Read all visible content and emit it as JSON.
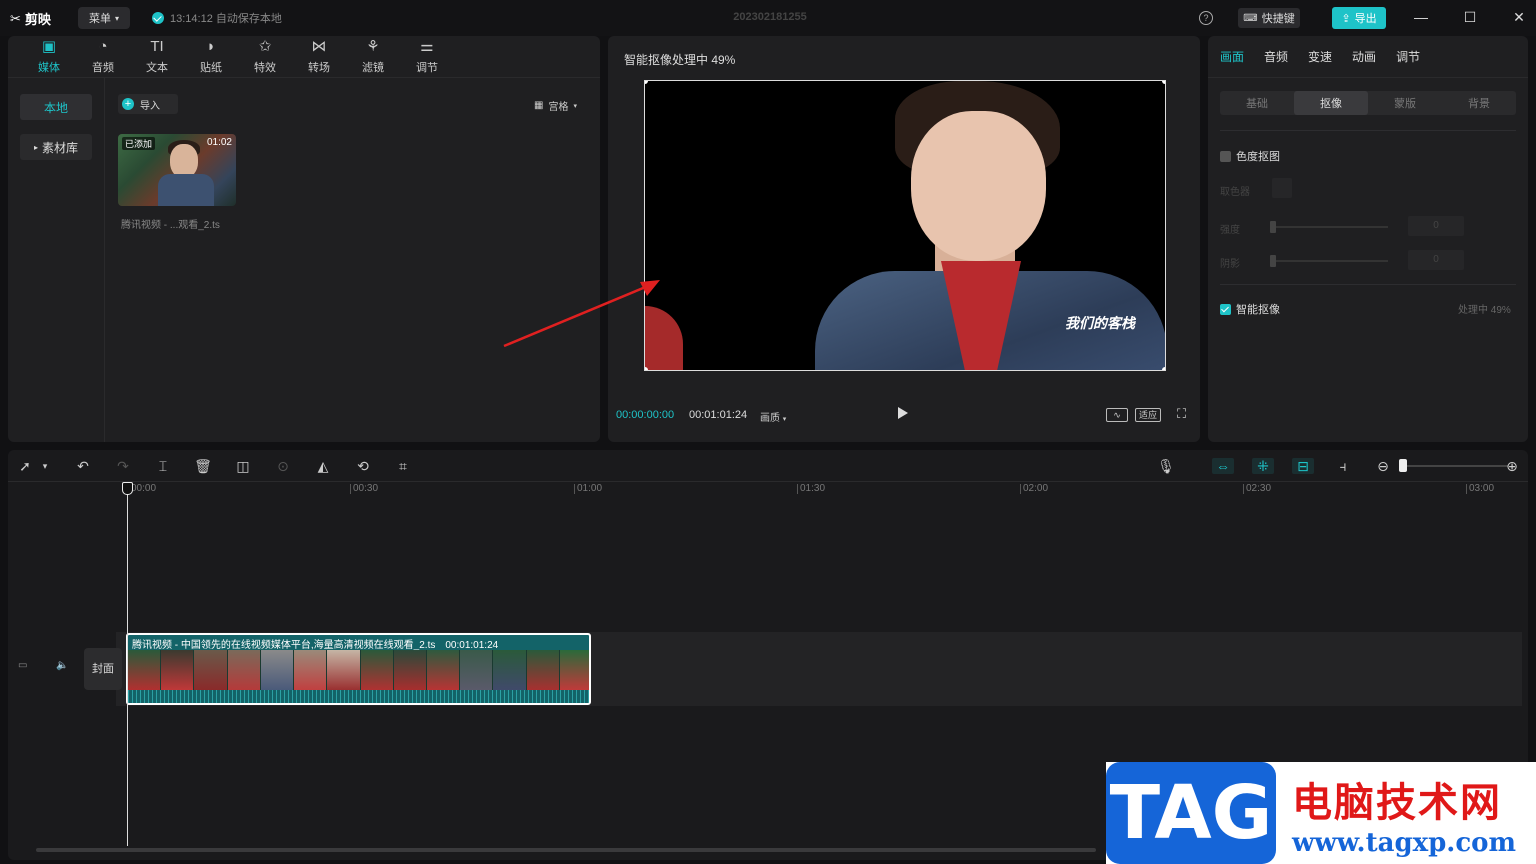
{
  "titlebar": {
    "app_name": "剪映",
    "menu_label": "菜单",
    "save_status": "13:14:12 自动保存本地",
    "project_name": "202302181255",
    "shortcut_label": "快捷键",
    "export_label": "导出"
  },
  "media_panel": {
    "tabs": [
      {
        "label": "媒体",
        "icon": "media-icon"
      },
      {
        "label": "音频",
        "icon": "audio-icon"
      },
      {
        "label": "文本",
        "icon": "text-icon"
      },
      {
        "label": "贴纸",
        "icon": "sticker-icon"
      },
      {
        "label": "特效",
        "icon": "effects-icon"
      },
      {
        "label": "转场",
        "icon": "transition-icon"
      },
      {
        "label": "滤镜",
        "icon": "filter-icon"
      },
      {
        "label": "调节",
        "icon": "adjust-icon"
      }
    ],
    "sidebar": [
      "本地",
      "素材库"
    ],
    "import_label": "导入",
    "view_label": "宫格",
    "clip": {
      "added_tag": "已添加",
      "duration": "01:02",
      "name": "腾讯视频 - ...观看_2.ts"
    }
  },
  "preview": {
    "title": "智能抠像处理中 49%",
    "current_time": "00:00:00:00",
    "total_time": "00:01:01:24",
    "quality_label": "画质",
    "fit_label": "适应",
    "watermark_text": "我们的客栈"
  },
  "properties": {
    "tabs": [
      "画面",
      "音频",
      "变速",
      "动画",
      "调节"
    ],
    "sub_tabs": [
      "基础",
      "抠像",
      "蒙版",
      "背景"
    ],
    "chroma_key_label": "色度抠图",
    "picker_label": "取色器",
    "strength_label": "强度",
    "shadow_label": "阴影",
    "strength_value": "0",
    "shadow_value": "0",
    "smart_cutout_label": "智能抠像",
    "smart_cutout_status": "处理中 49%"
  },
  "timeline": {
    "ruler": [
      "00:00",
      "00:30",
      "01:00",
      "01:30",
      "02:00",
      "02:30",
      "03:00"
    ],
    "cover_label": "封面",
    "clip_title": "腾讯视频 - 中国领先的在线视频媒体平台,海量高清视频在线观看_2.ts",
    "clip_duration": "00:01:01:24"
  },
  "watermark": {
    "tag": "TAG",
    "site_name": "电脑技术网",
    "url": "www.tagxp.com"
  }
}
